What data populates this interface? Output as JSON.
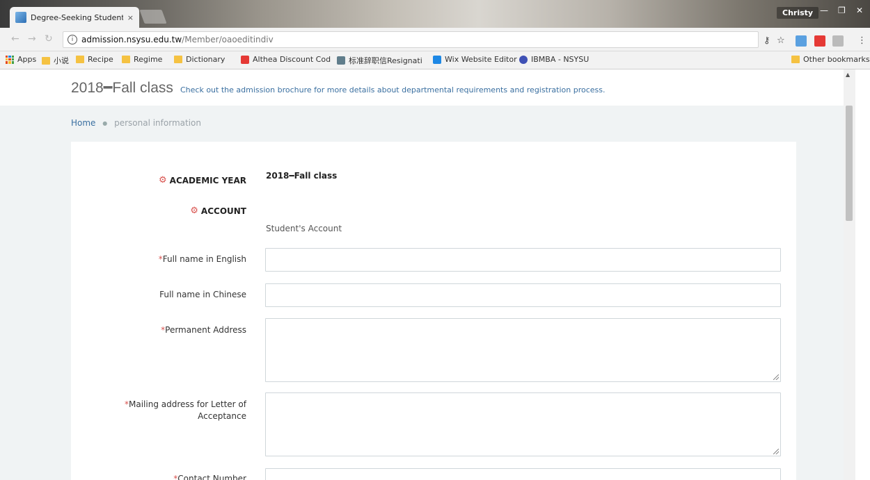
{
  "browser": {
    "tab_title": "Degree-Seeking Student",
    "tab_close": "×",
    "user": "Christy",
    "url_host": "admission.nsysu.edu.tw",
    "url_path": "/Member/oaoeditindiv",
    "bookmarks": [
      {
        "label": "Apps",
        "icon": "apps-icon"
      },
      {
        "label": "小说",
        "icon": "folder-icon"
      },
      {
        "label": "Recipe",
        "icon": "folder-icon"
      },
      {
        "label": "Regime",
        "icon": "folder-icon"
      },
      {
        "label": "Dictionary",
        "icon": "folder-icon"
      },
      {
        "label": "Althea Discount Cod",
        "icon": "althea-icon"
      },
      {
        "label": "标准辞职信Resignati",
        "icon": "doc-icon"
      },
      {
        "label": "Wix Website Editor",
        "icon": "wix-icon"
      },
      {
        "label": "IBMBA - NSYSU",
        "icon": "globe-icon"
      },
      {
        "label": "Other bookmarks",
        "icon": "folder-icon"
      }
    ]
  },
  "page": {
    "heading": "2018━Fall class",
    "heading_note": "Check out the admission brochure for more details about departmental requirements and registration process.",
    "breadcrumb": {
      "home": "Home",
      "current": "personal information"
    },
    "academic_year_label": "ACADEMIC YEAR",
    "academic_year_value": "2018━Fall class",
    "account_label": "ACCOUNT",
    "account_value": "Student's Account",
    "fields": {
      "full_name_en": "Full name in English",
      "full_name_zh": "Full name in Chinese",
      "permanent_address": "Permanent Address",
      "mailing_address_1": "Mailing address for Letter of",
      "mailing_address_2": "Acceptance",
      "contact_number": "Contact Number"
    },
    "required_mark": "*"
  },
  "colors": {
    "accent_link": "#3a6fa0",
    "required": "#d9534f",
    "band": "#f0f3f4"
  }
}
